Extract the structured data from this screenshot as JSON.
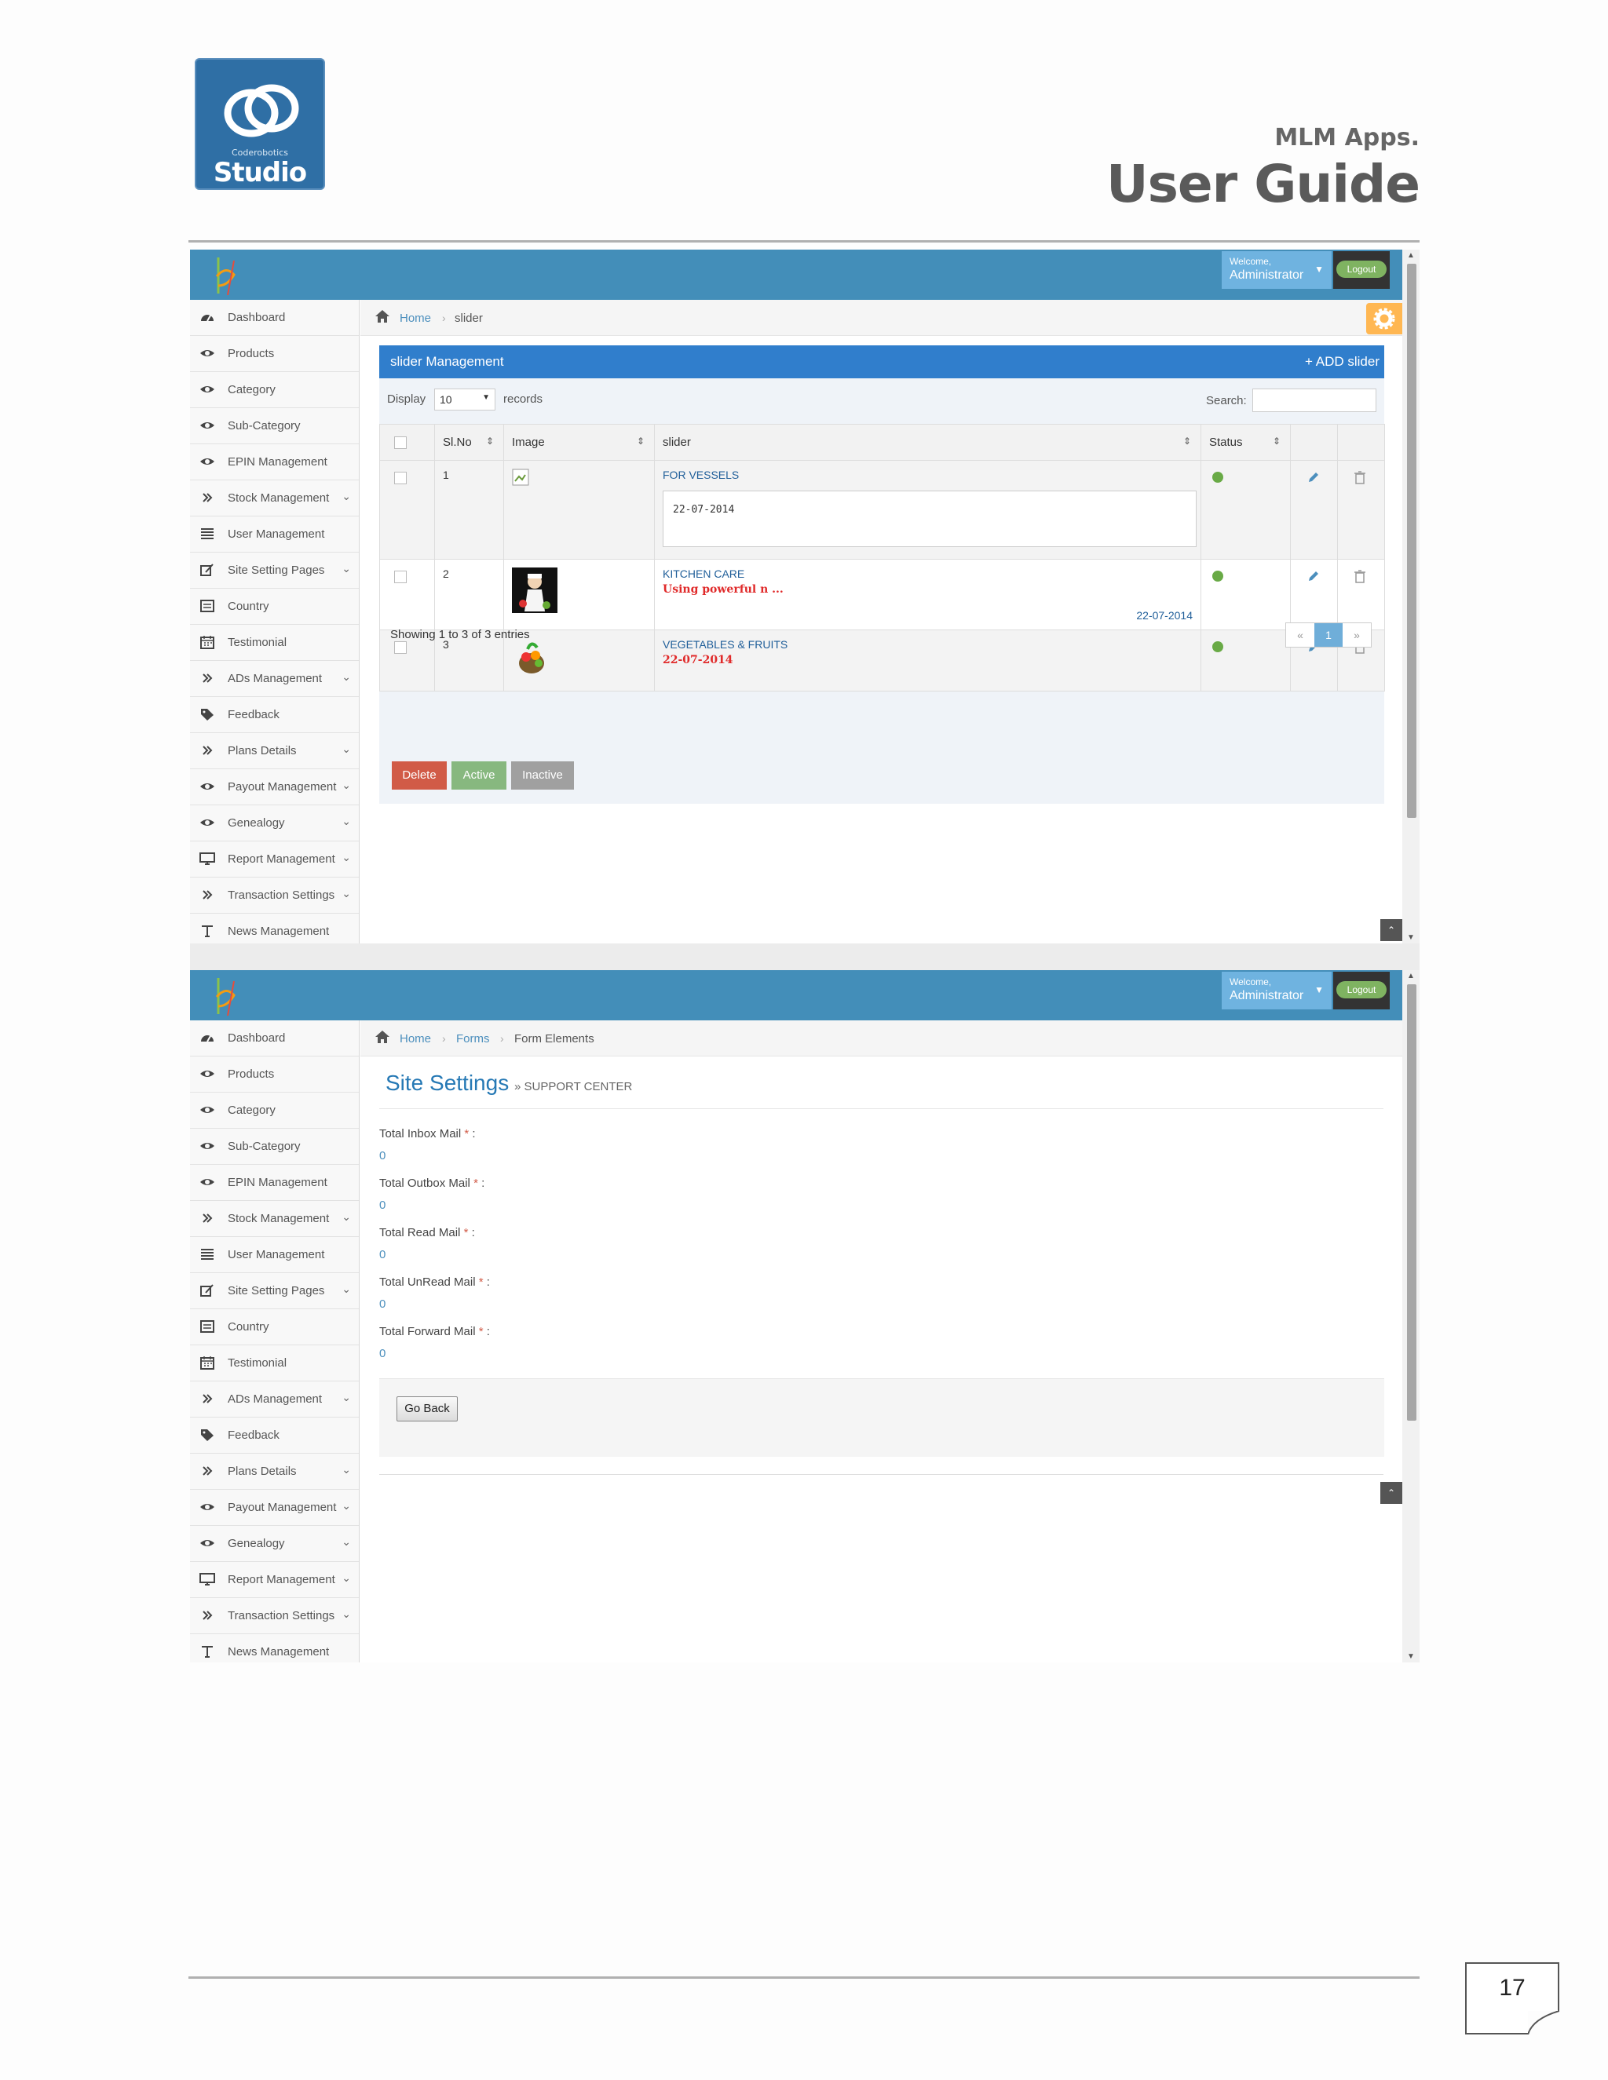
{
  "document": {
    "logo_small": "Coderobotics",
    "logo_brand": "Studio",
    "subtitle": "MLM Apps.",
    "title": "User Guide",
    "page_number": "17"
  },
  "header": {
    "welcome": "Welcome,",
    "user": "Administrator",
    "logout": "Logout"
  },
  "sidebar": {
    "items": [
      {
        "label": "Dashboard",
        "icon": "dashboard-icon",
        "has_submenu": false
      },
      {
        "label": "Products",
        "icon": "eye-icon",
        "has_submenu": false
      },
      {
        "label": "Category",
        "icon": "eye-icon",
        "has_submenu": false
      },
      {
        "label": "Sub-Category",
        "icon": "eye-icon",
        "has_submenu": false
      },
      {
        "label": "EPIN Management",
        "icon": "eye-icon",
        "has_submenu": false
      },
      {
        "label": "Stock Management",
        "icon": "double-chevron-icon",
        "has_submenu": true
      },
      {
        "label": "User Management",
        "icon": "list-icon",
        "has_submenu": false
      },
      {
        "label": "Site Setting Pages",
        "icon": "edit-icon",
        "has_submenu": true
      },
      {
        "label": "Country",
        "icon": "list-alt-icon",
        "has_submenu": false
      },
      {
        "label": "Testimonial",
        "icon": "calendar-icon",
        "has_submenu": false
      },
      {
        "label": "ADs Management",
        "icon": "double-chevron-icon",
        "has_submenu": true
      },
      {
        "label": "Feedback",
        "icon": "tag-icon",
        "has_submenu": false
      },
      {
        "label": "Plans Details",
        "icon": "double-chevron-icon",
        "has_submenu": true
      },
      {
        "label": "Payout Management",
        "icon": "eye-icon",
        "has_submenu": true
      },
      {
        "label": "Genealogy",
        "icon": "eye-icon",
        "has_submenu": true
      },
      {
        "label": "Report Management",
        "icon": "desktop-icon",
        "has_submenu": true
      },
      {
        "label": "Transaction Settings",
        "icon": "double-chevron-icon",
        "has_submenu": true
      },
      {
        "label": "News Management",
        "icon": "text-icon",
        "has_submenu": false
      }
    ]
  },
  "slider_page": {
    "breadcrumb": {
      "home": "Home",
      "current": "slider"
    },
    "panel_title": "slider Management",
    "add_label": "+ ADD slider",
    "display_label": "Display",
    "display_value": "10",
    "records_label": "records",
    "search_label": "Search:",
    "columns": [
      "Sl.No",
      "Image",
      "slider",
      "Status"
    ],
    "rows": [
      {
        "no": "1",
        "title": "FOR VESSELS",
        "date": "22-07-2014"
      },
      {
        "no": "2",
        "title": "KITCHEN CARE",
        "desc": "Using powerful n ...",
        "date": "22-07-2014"
      },
      {
        "no": "3",
        "title": "VEGETABLES & FRUITS",
        "date": "22-07-2014"
      }
    ],
    "showing": "Showing 1 to 3 of 3 entries",
    "pager": {
      "prev": "«",
      "page": "1",
      "next": "»"
    },
    "buttons": {
      "delete": "Delete",
      "active": "Active",
      "inactive": "Inactive"
    }
  },
  "settings_page": {
    "breadcrumb": {
      "home": "Home",
      "forms": "Forms",
      "current": "Form Elements"
    },
    "title": "Site Settings",
    "subtitle": "» SUPPORT CENTER",
    "fields": [
      {
        "label": "Total Inbox Mail",
        "value": "0"
      },
      {
        "label": "Total Outbox Mail",
        "value": "0"
      },
      {
        "label": "Total Read Mail",
        "value": "0"
      },
      {
        "label": "Total UnRead Mail",
        "value": "0"
      },
      {
        "label": "Total Forward Mail",
        "value": "0"
      }
    ],
    "required_mark": "*",
    "colon": ":",
    "go_back": "Go Back"
  },
  "colors": {
    "topbar": "#438eb9",
    "panel_header": "#307ecc",
    "status_active": "#69aa46",
    "delete": "#d15b47",
    "active": "#87b87f",
    "inactive": "#a0a0a0"
  }
}
